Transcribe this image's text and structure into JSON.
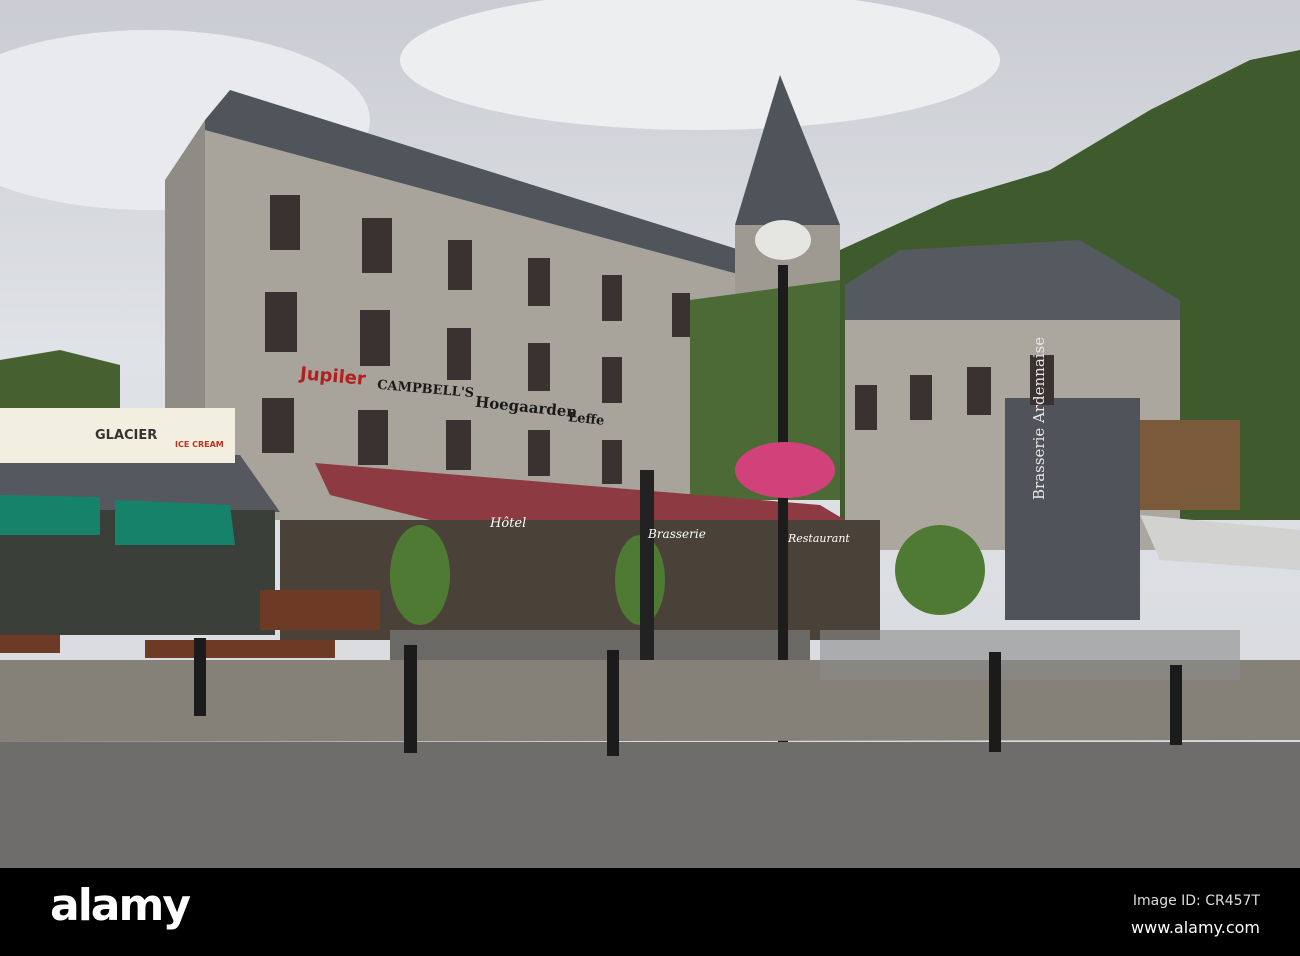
{
  "signs": {
    "jupiler": "Jupiler",
    "campbells": "CAMPBELL'S",
    "hoegaarden": "Hoegaarden",
    "leffe": "Leffe",
    "glacier": "GLACIER",
    "ice_cream": "ICE CREAM",
    "hotel": "Hôtel",
    "brasserie": "Brasserie",
    "restaurant": "Restaurant",
    "brasserie_ardennaise": "Brasserie Ardennaise"
  },
  "watermark": {
    "logo": "alamy",
    "image_id": "Image ID: CR457T",
    "website": "www.alamy.com"
  }
}
